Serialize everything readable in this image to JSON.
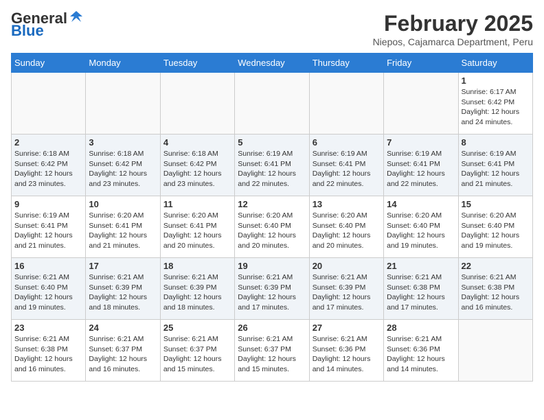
{
  "header": {
    "logo_general": "General",
    "logo_blue": "Blue",
    "month_year": "February 2025",
    "location": "Niepos, Cajamarca Department, Peru"
  },
  "weekdays": [
    "Sunday",
    "Monday",
    "Tuesday",
    "Wednesday",
    "Thursday",
    "Friday",
    "Saturday"
  ],
  "weeks": [
    [
      {
        "day": "",
        "detail": ""
      },
      {
        "day": "",
        "detail": ""
      },
      {
        "day": "",
        "detail": ""
      },
      {
        "day": "",
        "detail": ""
      },
      {
        "day": "",
        "detail": ""
      },
      {
        "day": "",
        "detail": ""
      },
      {
        "day": "1",
        "detail": "Sunrise: 6:17 AM\nSunset: 6:42 PM\nDaylight: 12 hours and 24 minutes."
      }
    ],
    [
      {
        "day": "2",
        "detail": "Sunrise: 6:18 AM\nSunset: 6:42 PM\nDaylight: 12 hours and 23 minutes."
      },
      {
        "day": "3",
        "detail": "Sunrise: 6:18 AM\nSunset: 6:42 PM\nDaylight: 12 hours and 23 minutes."
      },
      {
        "day": "4",
        "detail": "Sunrise: 6:18 AM\nSunset: 6:42 PM\nDaylight: 12 hours and 23 minutes."
      },
      {
        "day": "5",
        "detail": "Sunrise: 6:19 AM\nSunset: 6:41 PM\nDaylight: 12 hours and 22 minutes."
      },
      {
        "day": "6",
        "detail": "Sunrise: 6:19 AM\nSunset: 6:41 PM\nDaylight: 12 hours and 22 minutes."
      },
      {
        "day": "7",
        "detail": "Sunrise: 6:19 AM\nSunset: 6:41 PM\nDaylight: 12 hours and 22 minutes."
      },
      {
        "day": "8",
        "detail": "Sunrise: 6:19 AM\nSunset: 6:41 PM\nDaylight: 12 hours and 21 minutes."
      }
    ],
    [
      {
        "day": "9",
        "detail": "Sunrise: 6:19 AM\nSunset: 6:41 PM\nDaylight: 12 hours and 21 minutes."
      },
      {
        "day": "10",
        "detail": "Sunrise: 6:20 AM\nSunset: 6:41 PM\nDaylight: 12 hours and 21 minutes."
      },
      {
        "day": "11",
        "detail": "Sunrise: 6:20 AM\nSunset: 6:41 PM\nDaylight: 12 hours and 20 minutes."
      },
      {
        "day": "12",
        "detail": "Sunrise: 6:20 AM\nSunset: 6:40 PM\nDaylight: 12 hours and 20 minutes."
      },
      {
        "day": "13",
        "detail": "Sunrise: 6:20 AM\nSunset: 6:40 PM\nDaylight: 12 hours and 20 minutes."
      },
      {
        "day": "14",
        "detail": "Sunrise: 6:20 AM\nSunset: 6:40 PM\nDaylight: 12 hours and 19 minutes."
      },
      {
        "day": "15",
        "detail": "Sunrise: 6:20 AM\nSunset: 6:40 PM\nDaylight: 12 hours and 19 minutes."
      }
    ],
    [
      {
        "day": "16",
        "detail": "Sunrise: 6:21 AM\nSunset: 6:40 PM\nDaylight: 12 hours and 19 minutes."
      },
      {
        "day": "17",
        "detail": "Sunrise: 6:21 AM\nSunset: 6:39 PM\nDaylight: 12 hours and 18 minutes."
      },
      {
        "day": "18",
        "detail": "Sunrise: 6:21 AM\nSunset: 6:39 PM\nDaylight: 12 hours and 18 minutes."
      },
      {
        "day": "19",
        "detail": "Sunrise: 6:21 AM\nSunset: 6:39 PM\nDaylight: 12 hours and 17 minutes."
      },
      {
        "day": "20",
        "detail": "Sunrise: 6:21 AM\nSunset: 6:39 PM\nDaylight: 12 hours and 17 minutes."
      },
      {
        "day": "21",
        "detail": "Sunrise: 6:21 AM\nSunset: 6:38 PM\nDaylight: 12 hours and 17 minutes."
      },
      {
        "day": "22",
        "detail": "Sunrise: 6:21 AM\nSunset: 6:38 PM\nDaylight: 12 hours and 16 minutes."
      }
    ],
    [
      {
        "day": "23",
        "detail": "Sunrise: 6:21 AM\nSunset: 6:38 PM\nDaylight: 12 hours and 16 minutes."
      },
      {
        "day": "24",
        "detail": "Sunrise: 6:21 AM\nSunset: 6:37 PM\nDaylight: 12 hours and 16 minutes."
      },
      {
        "day": "25",
        "detail": "Sunrise: 6:21 AM\nSunset: 6:37 PM\nDaylight: 12 hours and 15 minutes."
      },
      {
        "day": "26",
        "detail": "Sunrise: 6:21 AM\nSunset: 6:37 PM\nDaylight: 12 hours and 15 minutes."
      },
      {
        "day": "27",
        "detail": "Sunrise: 6:21 AM\nSunset: 6:36 PM\nDaylight: 12 hours and 14 minutes."
      },
      {
        "day": "28",
        "detail": "Sunrise: 6:21 AM\nSunset: 6:36 PM\nDaylight: 12 hours and 14 minutes."
      },
      {
        "day": "",
        "detail": ""
      }
    ]
  ]
}
